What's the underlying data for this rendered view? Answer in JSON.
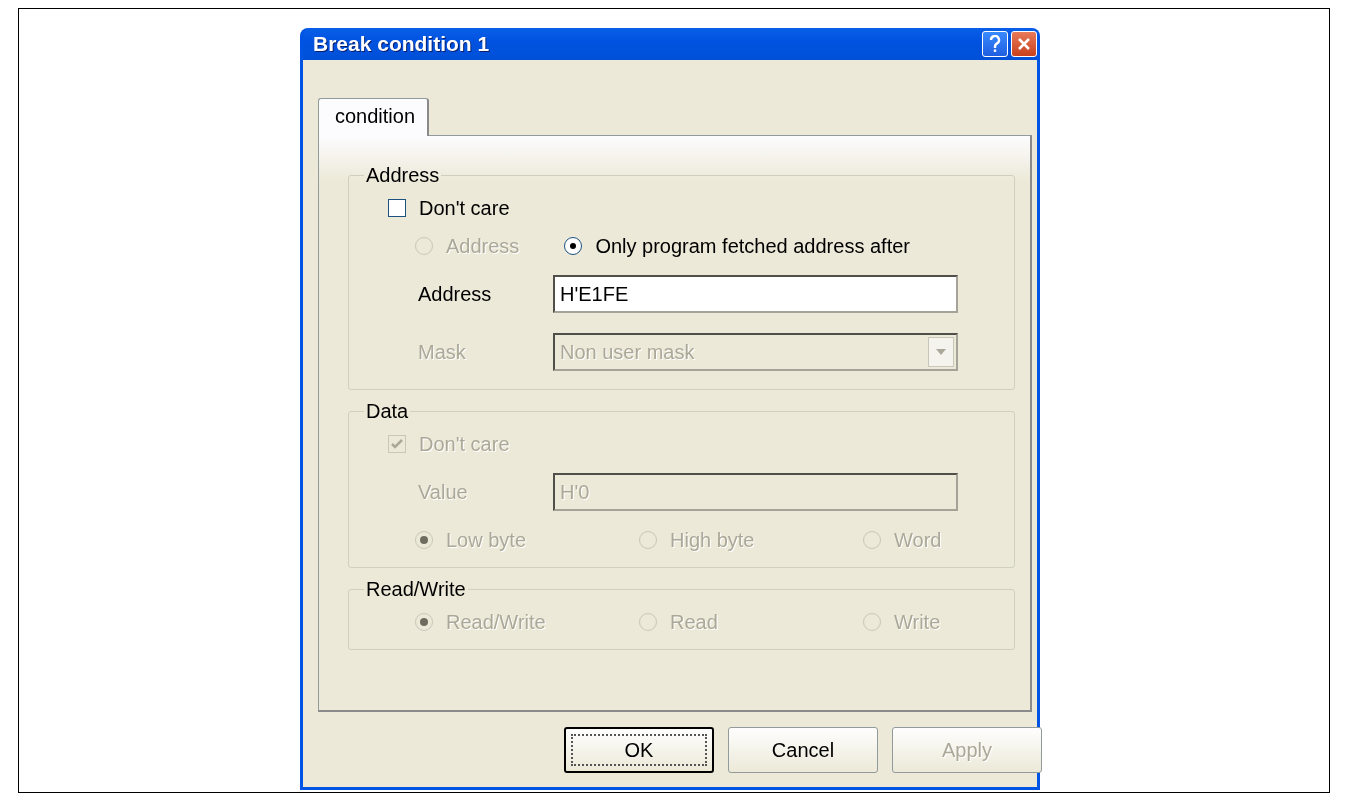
{
  "window": {
    "title": "Break condition 1"
  },
  "tabs": [
    {
      "label": "condition",
      "selected": true
    }
  ],
  "groups": [
    {
      "title": "Address",
      "items": [
        {
          "kind": "checkbox",
          "label": "Don't care",
          "checked": false,
          "disabled": false
        },
        {
          "kind": "radio_row",
          "options": [
            {
              "label": "Address",
              "selected": false,
              "disabled": true
            },
            {
              "label": "Only program fetched address after",
              "selected": true,
              "disabled": false
            }
          ]
        },
        {
          "kind": "field",
          "label": "Address",
          "value": "H'E1FE",
          "disabled": false
        },
        {
          "kind": "dropdown",
          "label": "Mask",
          "value": "Non user mask",
          "disabled": true
        }
      ]
    },
    {
      "title": "Data",
      "items": [
        {
          "kind": "checkbox",
          "label": "Don't care",
          "checked": true,
          "disabled": true
        },
        {
          "kind": "field",
          "label": "Value",
          "value": "H'0",
          "disabled": true
        },
        {
          "kind": "radio_row",
          "options": [
            {
              "label": "Low byte",
              "selected": true,
              "disabled": true
            },
            {
              "label": "High byte",
              "selected": false,
              "disabled": true
            },
            {
              "label": "Word",
              "selected": false,
              "disabled": true
            }
          ]
        }
      ]
    },
    {
      "title": "Read/Write",
      "items": [
        {
          "kind": "radio_row",
          "options": [
            {
              "label": "Read/Write",
              "selected": true,
              "disabled": true
            },
            {
              "label": "Read",
              "selected": false,
              "disabled": true
            },
            {
              "label": "Write",
              "selected": false,
              "disabled": true
            }
          ]
        }
      ]
    }
  ],
  "buttons": [
    {
      "label": "OK",
      "default": true,
      "disabled": false
    },
    {
      "label": "Cancel",
      "default": false,
      "disabled": false
    },
    {
      "label": "Apply",
      "default": false,
      "disabled": true
    }
  ]
}
